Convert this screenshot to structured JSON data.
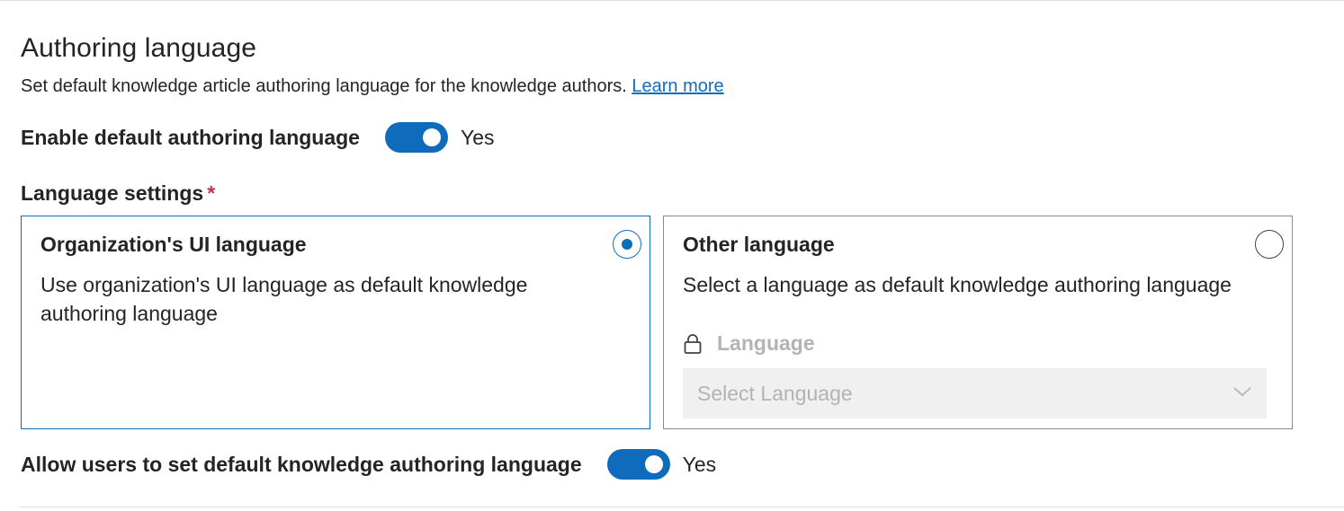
{
  "authoring_language": {
    "title": "Authoring language",
    "description": "Set default knowledge article authoring language for the knowledge authors.",
    "learn_more": "Learn more"
  },
  "enable_default": {
    "label": "Enable default authoring language",
    "state": "Yes",
    "checked": true
  },
  "language_settings": {
    "label": "Language settings",
    "required_marker": "*",
    "options": [
      {
        "title": "Organization's UI language",
        "description": "Use organization's UI language as default knowledge authoring language",
        "selected": true
      },
      {
        "title": "Other language",
        "description": "Select a language as default knowledge authoring language",
        "selected": false,
        "field_label": "Language",
        "field_icon": "lock-icon",
        "select_placeholder": "Select Language",
        "select_icon": "chevron-down-icon"
      }
    ]
  },
  "allow_users": {
    "label": "Allow users to set default knowledge authoring language",
    "state": "Yes",
    "checked": true
  },
  "colors": {
    "accent": "#0f6cbd",
    "required": "#c4314b",
    "disabled_text": "#b3b3b3",
    "disabled_bg": "#f0f0f0"
  }
}
